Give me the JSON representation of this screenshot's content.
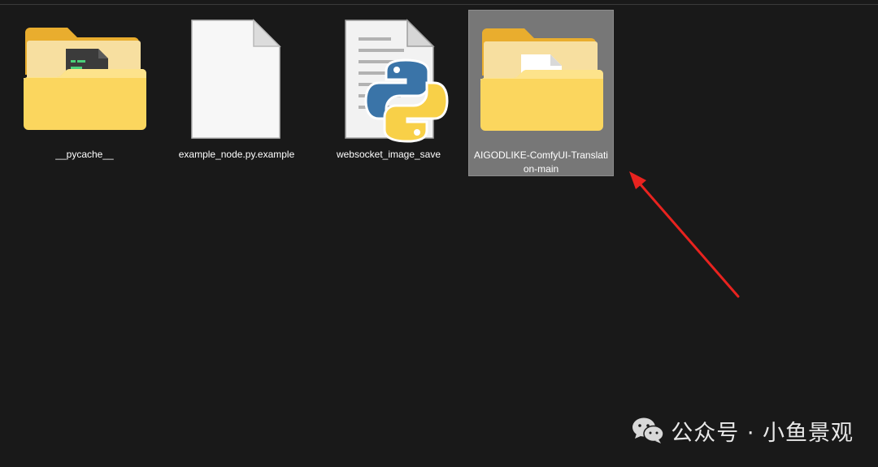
{
  "files": [
    {
      "name": "__pycache__",
      "type": "folder",
      "icon": "python-folder-icon",
      "selected": false
    },
    {
      "name": "example_node.py.example",
      "type": "file",
      "icon": "blank-file-icon",
      "selected": false
    },
    {
      "name": "websocket_image_save",
      "type": "file",
      "icon": "python-file-icon",
      "selected": false
    },
    {
      "name": "AIGODLIKE-ComfyUI-Translation-main",
      "type": "folder",
      "icon": "folder-icon",
      "selected": true
    }
  ],
  "annotation": {
    "icon": "red-arrow-icon",
    "color": "#e8231f"
  },
  "watermark": {
    "text": "公众号 · 小鱼景观",
    "icon": "wechat-icon"
  },
  "colors": {
    "background": "#191919",
    "selection": "#777777",
    "folder": "#f7c94f"
  }
}
